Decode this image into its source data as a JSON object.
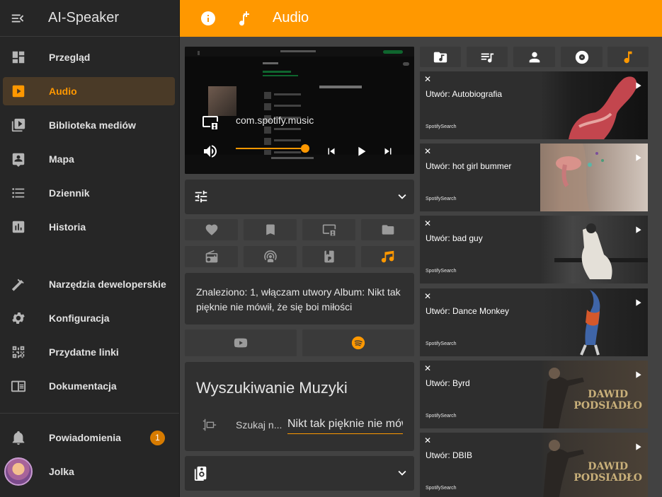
{
  "app": {
    "title": "AI-Speaker"
  },
  "sidebar": {
    "items": [
      {
        "label": "Przegląd",
        "icon": "dashboard-icon"
      },
      {
        "label": "Audio",
        "icon": "play-box-icon",
        "active": true
      },
      {
        "label": "Biblioteka mediów",
        "icon": "media-library-icon"
      },
      {
        "label": "Mapa",
        "icon": "map-account-icon"
      },
      {
        "label": "Dziennik",
        "icon": "list-icon"
      },
      {
        "label": "Historia",
        "icon": "chart-box-icon"
      },
      {
        "label": "Narzędzia deweloperskie",
        "icon": "hammer-icon"
      },
      {
        "label": "Konfiguracja",
        "icon": "gear-icon"
      },
      {
        "label": "Przydatne linki",
        "icon": "qrcode-icon"
      },
      {
        "label": "Dokumentacja",
        "icon": "book-icon"
      }
    ],
    "notifications": {
      "label": "Powiadomienia",
      "count": "1"
    },
    "user": {
      "name": "Jolka"
    }
  },
  "topbar": {
    "title": "Audio"
  },
  "player": {
    "source": "com.spotify.music",
    "progress": 0.65
  },
  "status": {
    "message": "Znaleziono: 1, włączam utwory Album: Nikt tak pięknie nie mówił, że się boi miłości"
  },
  "search": {
    "title": "Wyszukiwanie Muzyki",
    "label": "Szukaj n...",
    "value": "Nikt tak pięknie nie mówił"
  },
  "results": [
    {
      "title": "Utwór: Autobiografia",
      "source": "SpotifySearch",
      "art": "arm"
    },
    {
      "title": "Utwór: hot girl bummer",
      "source": "SpotifySearch",
      "art": "face"
    },
    {
      "title": "Utwór: bad guy",
      "source": "SpotifySearch",
      "art": "girl"
    },
    {
      "title": "Utwór: Dance Monkey",
      "source": "SpotifySearch",
      "art": "dancer"
    },
    {
      "title": "Utwór: Byrd",
      "source": "SpotifySearch",
      "art": "dawid"
    },
    {
      "title": "Utwór: DBIB",
      "source": "SpotifySearch",
      "art": "dawid"
    }
  ],
  "album_art_text": {
    "line1": "DAWID",
    "line2": "PODSIADŁO"
  },
  "colors": {
    "accent": "#ff9800",
    "sidebar": "#262626",
    "background": "#424242",
    "card": "#303030",
    "active_bg": "#4a3a27"
  }
}
